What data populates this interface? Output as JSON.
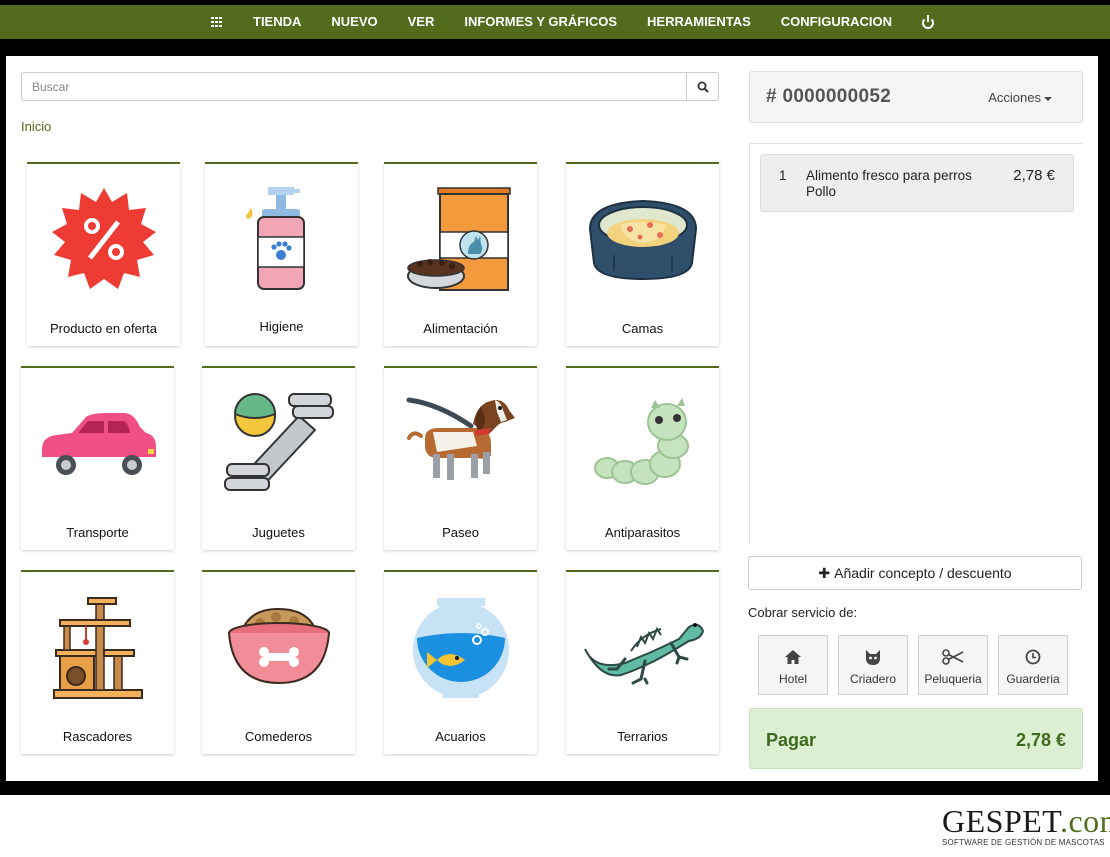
{
  "nav": {
    "apps_icon": "grid-icon",
    "items": [
      "TIENDA",
      "NUEVO",
      "VER",
      "INFORMES Y GRÁFICOS",
      "HERRAMIENTAS",
      "CONFIGURACION"
    ],
    "power_icon": "power-icon",
    "color": "#526b1d"
  },
  "search": {
    "placeholder": "Buscar",
    "value": "",
    "icon": "search-icon"
  },
  "breadcrumb": "Inicio",
  "categories": [
    {
      "label": "Producto en oferta",
      "icon": "discount-badge-icon"
    },
    {
      "label": "Higiene",
      "icon": "soap-dispenser-icon"
    },
    {
      "label": "Alimentación",
      "icon": "pet-food-bag-icon"
    },
    {
      "label": "Camas",
      "icon": "pet-bed-icon"
    },
    {
      "label": "Transporte",
      "icon": "car-icon"
    },
    {
      "label": "Juguetes",
      "icon": "toy-icon"
    },
    {
      "label": "Paseo",
      "icon": "dog-on-leash-icon"
    },
    {
      "label": "Antiparasitos",
      "icon": "worm-icon"
    },
    {
      "label": "Rascadores",
      "icon": "scratching-post-icon"
    },
    {
      "label": "Comederos",
      "icon": "food-bowl-icon"
    },
    {
      "label": "Acuarios",
      "icon": "fish-bowl-icon"
    },
    {
      "label": "Terrarios",
      "icon": "iguana-icon"
    }
  ],
  "ticket": {
    "number": "# 0000000052",
    "actions_label": "Acciones",
    "lines": [
      {
        "qty": "1",
        "desc_line1": "Alimento fresco para perros",
        "desc_line2": "Pollo",
        "price": "2,78 €"
      }
    ]
  },
  "add_concept_label": "Añadir concepto / descuento",
  "charge_label": "Cobrar servicio de:",
  "services": [
    {
      "label": "Hotel",
      "icon": "home-icon"
    },
    {
      "label": "Criadero",
      "icon": "cat-icon"
    },
    {
      "label": "Peluqueria",
      "icon": "scissors-icon"
    },
    {
      "label": "Guarderia",
      "icon": "clock-icon"
    }
  ],
  "pay": {
    "label": "Pagar",
    "amount": "2,78 €",
    "color": "#dcefd2"
  },
  "brand": {
    "name": "GESPET",
    "tld": ".com",
    "tagline": "SOFTWARE DE GESTIÓN DE MASCOTAS"
  }
}
